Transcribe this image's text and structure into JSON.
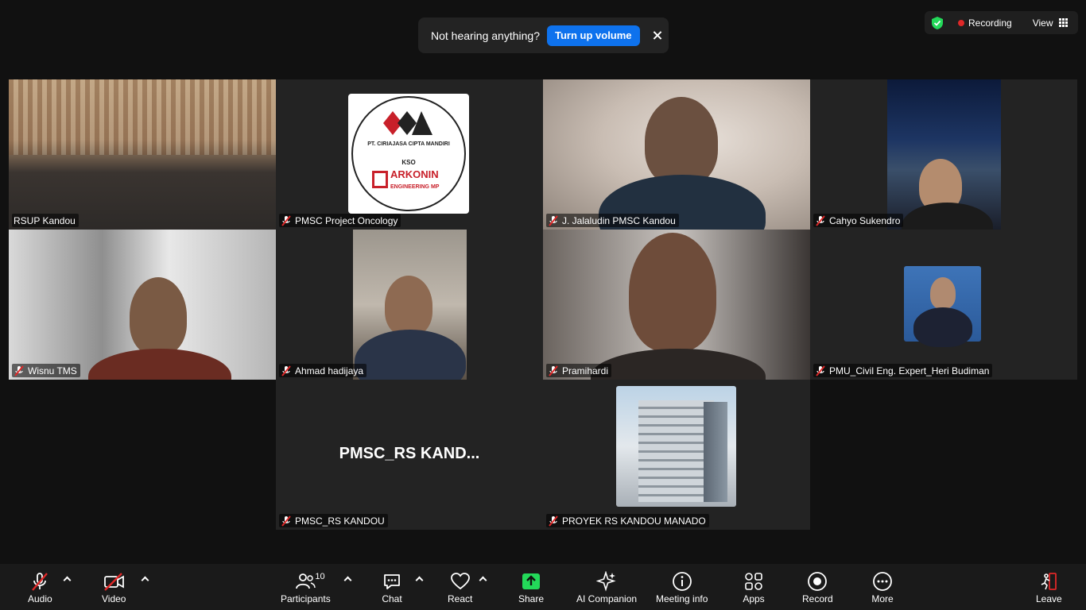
{
  "notification": {
    "message": "Not hearing anything?",
    "action_label": "Turn up volume"
  },
  "status": {
    "recording_label": "Recording",
    "view_label": "View"
  },
  "participants": [
    {
      "name": "RSUP Kandou"
    },
    {
      "name": "PMSC Project Oncology"
    },
    {
      "name": "J. Jalaludin PMSC Kandou"
    },
    {
      "name": "Cahyo Sukendro"
    },
    {
      "name": "Wisnu TMS"
    },
    {
      "name": "Ahmad hadijaya"
    },
    {
      "name": "Pramihardi"
    },
    {
      "name": "PMU_Civil Eng. Expert_Heri Budiman"
    },
    {
      "name": "PMSC_RS KANDOU",
      "display_text": "PMSC_RS  KAND..."
    },
    {
      "name": "PROYEK RS KANDOU MANADO"
    }
  ],
  "logo": {
    "company": "PT. CIRIAJASA CIPTA MANDIRI",
    "kso": "KSO",
    "brand": "ARKONIN",
    "brand_sub": "ENGINEERING MP"
  },
  "toolbar": {
    "audio": "Audio",
    "video": "Video",
    "participants": "Participants",
    "participant_count": "10",
    "chat": "Chat",
    "react": "React",
    "share": "Share",
    "ai_companion": "AI Companion",
    "meeting_info": "Meeting info",
    "apps": "Apps",
    "record": "Record",
    "more": "More",
    "leave": "Leave"
  },
  "colors": {
    "active_speaker": "#23d959",
    "primary_button": "#0e72ed",
    "recording": "#e02828",
    "share": "#23d959",
    "muted": "#e02828",
    "leave": "#e02828"
  }
}
